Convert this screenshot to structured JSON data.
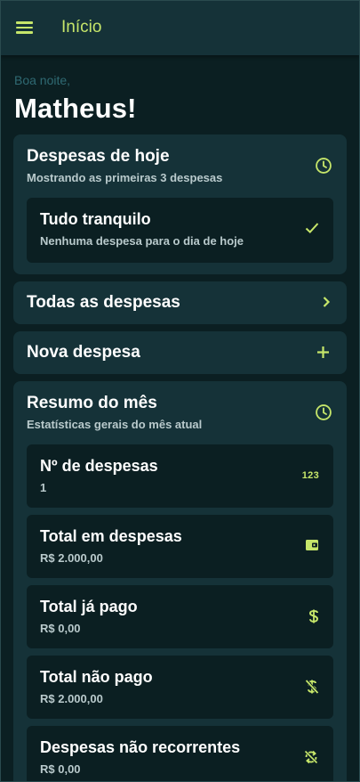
{
  "appbar": {
    "title": "Início",
    "menu_icon": "menu-icon"
  },
  "greeting": {
    "salutation": "Boa noite,",
    "name": "Matheus!"
  },
  "today": {
    "title": "Despesas de hoje",
    "subtitle": "Mostrando as primeiras 3 despesas",
    "icon": "clock-icon",
    "empty": {
      "title": "Tudo tranquilo",
      "subtitle": "Nenhuma despesa para o dia de hoje",
      "icon": "check-icon"
    }
  },
  "all_expenses": {
    "label": "Todas as despesas",
    "icon": "chevron-right-icon"
  },
  "new_expense": {
    "label": "Nova despesa",
    "icon": "plus-icon"
  },
  "summary": {
    "title": "Resumo do mês",
    "subtitle": "Estatísticas gerais do mês atual",
    "icon": "clock-icon",
    "stats": [
      {
        "label": "Nº de despesas",
        "value": "1",
        "icon": "numbers-icon",
        "icon_text": "123"
      },
      {
        "label": "Total em despesas",
        "value": "R$ 2.000,00",
        "icon": "wallet-icon"
      },
      {
        "label": "Total já pago",
        "value": "R$ 0,00",
        "icon": "dollar-icon"
      },
      {
        "label": "Total não pago",
        "value": "R$ 2.000,00",
        "icon": "no-dollar-icon"
      },
      {
        "label": "Despesas não recorrentes",
        "value": "R$ 0,00",
        "icon": "sync-disabled-icon"
      }
    ]
  },
  "colors": {
    "accent": "#c6e66a",
    "surface": "#153238",
    "background": "#0b1f22",
    "muted_text": "#b9cacc"
  }
}
